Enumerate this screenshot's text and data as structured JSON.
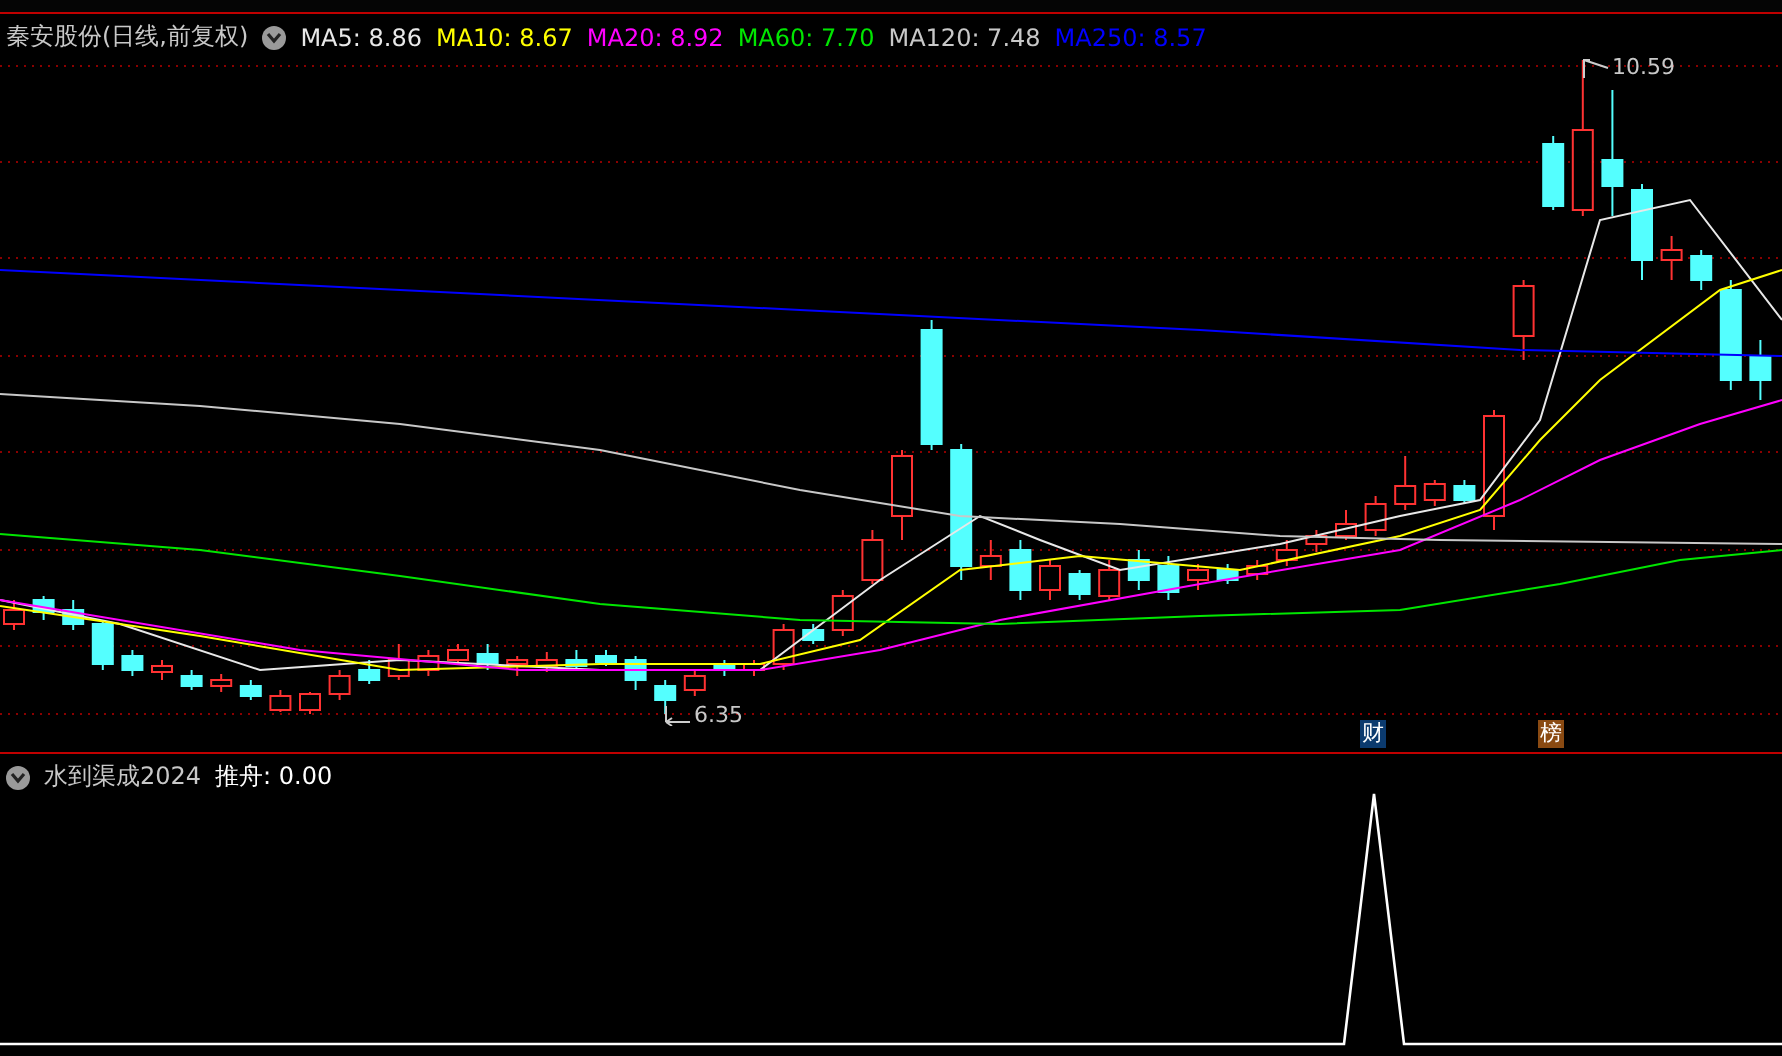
{
  "chart_header": {
    "title": "秦安股份(日线,前复权)"
  },
  "legend": [
    {
      "label": "MA5: 8.86",
      "color": "#e8e8e8"
    },
    {
      "label": "MA10: 8.67",
      "color": "#ffff00"
    },
    {
      "label": "MA20: 8.92",
      "color": "#ff00ff"
    },
    {
      "label": "MA60: 7.70",
      "color": "#00e600"
    },
    {
      "label": "MA120: 7.48",
      "color": "#c8c8c8"
    },
    {
      "label": "MA250: 8.57",
      "color": "#0000ff"
    }
  ],
  "price_marks": {
    "high": "10.59",
    "low": "6.35"
  },
  "badges": [
    {
      "text": "财",
      "color": "#0b3a6e"
    },
    {
      "text": "榜",
      "color": "#8a4a12"
    }
  ],
  "indicator": {
    "name": "水到渠成2024",
    "reading": "推舟: 0.00"
  }
}
